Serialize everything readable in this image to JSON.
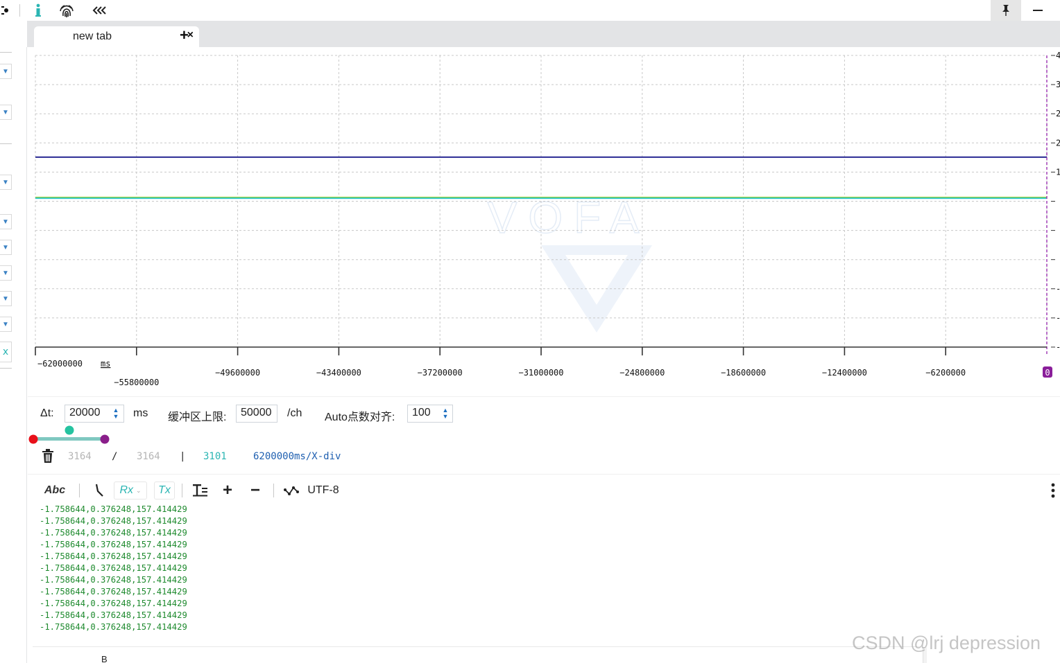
{
  "toolbar": {
    "icons": [
      "screenshot-icon",
      "info-icon",
      "fingerprint-icon",
      "collapse-left-icon",
      "pin-icon",
      "minimize-icon"
    ]
  },
  "tabs": [
    {
      "label": "new tab",
      "close": "×"
    }
  ],
  "tab_add": "+",
  "left_strip": {
    "expand_icon": "chevron-down-icon",
    "bottom_glyph": "x"
  },
  "chart": {
    "watermark": "VOFA",
    "x_unit": "ms",
    "x_ticks": [
      "-62000000",
      "-55800000",
      "-49600000",
      "-43400000",
      "-37200000",
      "-31000000",
      "-24800000",
      "-18600000",
      "-12400000",
      "-6200000"
    ],
    "cursor_badge": "0",
    "right_axis_ticks": [
      "4",
      "3",
      "2",
      "2",
      "1",
      "",
      "",
      "",
      "-",
      "-",
      "-"
    ],
    "colors": {
      "series_blue": "#1a1a8c",
      "series_green": "#9acd32",
      "series_cyan": "#34c9c9",
      "cursor": "#9b30b0"
    }
  },
  "chart_data": {
    "type": "line",
    "title": "",
    "xlabel": "ms",
    "ylabel": "",
    "x": [
      -62000000,
      0
    ],
    "xlim": [
      -62000000,
      0
    ],
    "series": [
      {
        "values": [
          1.35,
          1.35
        ]
      },
      {
        "values": [
          0.3,
          0.3
        ]
      },
      {
        "values": [
          0.28,
          0.28
        ]
      }
    ],
    "grid": true
  },
  "controls": {
    "dt_label": "Δt:",
    "dt_value": "20000",
    "dt_unit": "ms",
    "buffer_label": "缓冲区上限:",
    "buffer_value": "50000",
    "buffer_unit": "/ch",
    "auto_label": "Auto点数对齐:",
    "auto_value": "100"
  },
  "slider": {
    "colors": {
      "start": "#e8101a",
      "mid": "#25c3a0",
      "end": "#8a1e8a",
      "track": "#7fc8c0"
    }
  },
  "status": {
    "count_a": "3164",
    "slash": "/",
    "count_b": "3164",
    "bar": "|",
    "count_c": "3101",
    "xdiv": "6200000ms/X-div"
  },
  "rx_toolbar": {
    "abc": "Abc",
    "rx": "Rx",
    "tx": "Tx",
    "encoding": "UTF-8",
    "plus": "+",
    "minus": "−"
  },
  "log_lines": [
    "-1.758644,0.376248,157.414429",
    "-1.758644,0.376248,157.414429",
    "-1.758644,0.376248,157.414429",
    "-1.758644,0.376248,157.414429",
    "-1.758644,0.376248,157.414429",
    "-1.758644,0.376248,157.414429",
    "-1.758644,0.376248,157.414429",
    "-1.758644,0.376248,157.414429",
    "-1.758644,0.376248,157.414429",
    "-1.758644,0.376248,157.414429",
    "-1.758644,0.376248,157.414429"
  ],
  "bottom": {
    "label_b": "B",
    "watermark": "CSDN @lrj  depression"
  }
}
